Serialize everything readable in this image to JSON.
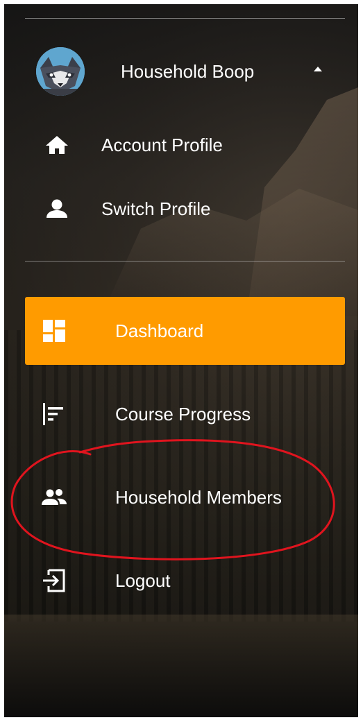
{
  "profile": {
    "name": "Household Boop",
    "avatar_icon": "wolf-avatar-icon",
    "expand_icon": "caret-up-icon"
  },
  "profile_menu": [
    {
      "label": "Account Profile",
      "icon": "home-icon"
    },
    {
      "label": "Switch Profile",
      "icon": "person-icon"
    }
  ],
  "nav": [
    {
      "label": "Dashboard",
      "icon": "dashboard-icon",
      "active": true
    },
    {
      "label": "Course Progress",
      "icon": "progress-icon",
      "active": false
    },
    {
      "label": "Household Members",
      "icon": "people-icon",
      "active": false
    },
    {
      "label": "Logout",
      "icon": "logout-icon",
      "active": false
    }
  ],
  "colors": {
    "accent": "#ff9b00",
    "text": "#ffffff",
    "annotation": "#e0141e",
    "avatar_bg": "#5fa6cf"
  }
}
